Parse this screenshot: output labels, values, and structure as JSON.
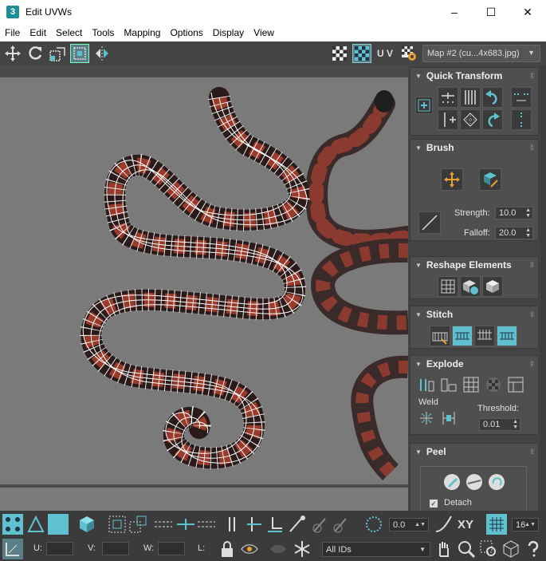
{
  "window": {
    "title": "Edit UVWs",
    "app_icon": "3",
    "minimize": "–",
    "maximize": "☐",
    "close": "✕"
  },
  "menu": [
    "File",
    "Edit",
    "Select",
    "Tools",
    "Mapping",
    "Options",
    "Display",
    "View"
  ],
  "toolbar": {
    "uv_label": "U V",
    "map_select": "Map #2 (cu...4x683.jpg)"
  },
  "panel": {
    "quick_transform": {
      "title": "Quick Transform"
    },
    "brush": {
      "title": "Brush",
      "strength_label": "Strength:",
      "strength_value": "10.0",
      "falloff_label": "Falloff:",
      "falloff_value": "20.0"
    },
    "reshape": {
      "title": "Reshape Elements"
    },
    "stitch": {
      "title": "Stitch"
    },
    "explode": {
      "title": "Explode",
      "weld_label": "Weld",
      "threshold_label": "Threshold:",
      "threshold_value": "0.01"
    },
    "peel": {
      "title": "Peel",
      "detach_label": "Detach"
    }
  },
  "bottom": {
    "rotate_value": "0.0",
    "xy_label": "XY",
    "grid_value": "16",
    "u_label": "U:",
    "v_label": "V:",
    "w_label": "W:",
    "l_label": "L:",
    "ids_select": "All IDs"
  },
  "colors": {
    "accent": "#5fc0d0",
    "panel_bg": "#444444",
    "viewport_bg": "#7a7a7a"
  }
}
